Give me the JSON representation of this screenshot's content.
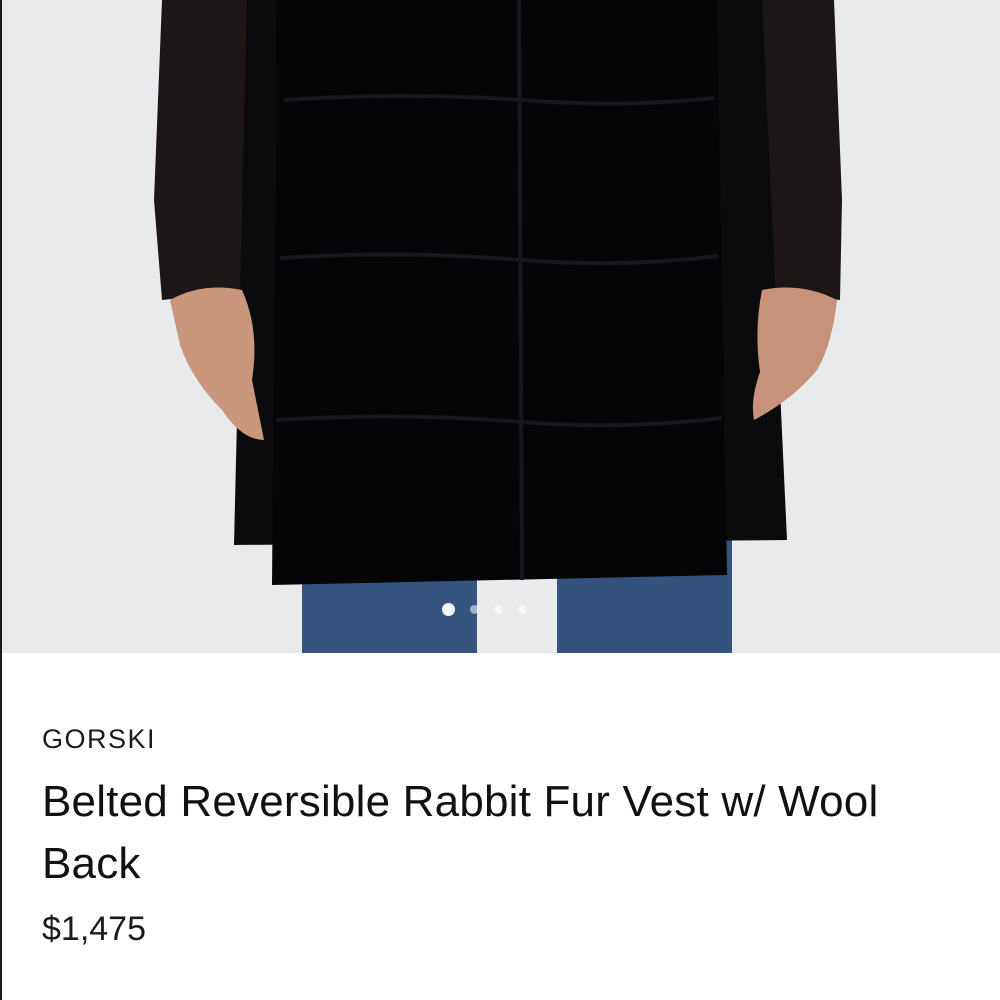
{
  "product": {
    "brand": "GORSKI",
    "title": "Belted Reversible Rabbit Fur Vest w/ Wool Back",
    "price": "$1,475"
  },
  "gallery": {
    "image_count": 4,
    "active_index": 0,
    "colors": {
      "background": "#e9eaec",
      "vest": "#050507",
      "sleeve": "#1d1616",
      "skin": "#c9977c",
      "denim": "#35557f"
    }
  }
}
